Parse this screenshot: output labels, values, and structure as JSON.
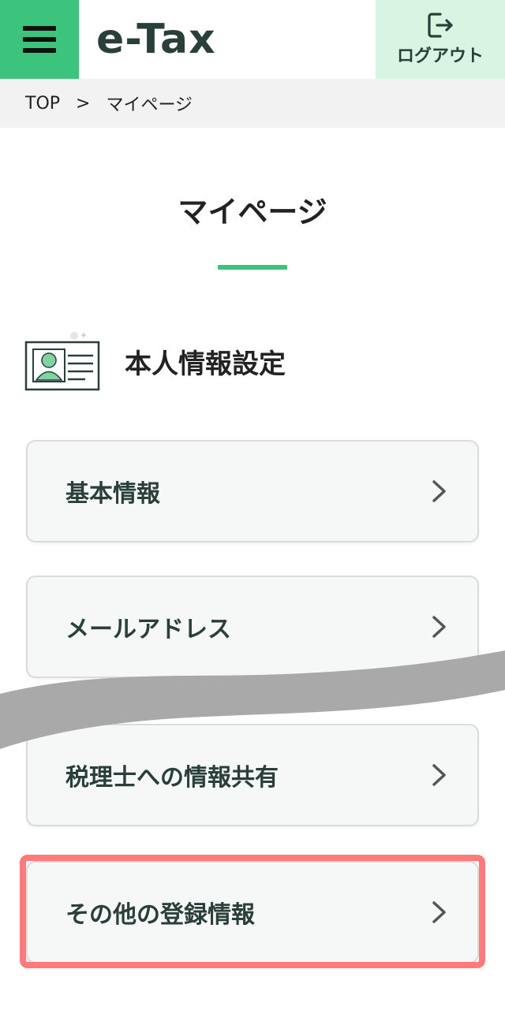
{
  "header": {
    "logo": "e-Tax",
    "logout_label": "ログアウト",
    "menu_icon": "hamburger-menu-icon",
    "logout_icon": "logout-icon",
    "accent_color": "#3cc47c"
  },
  "breadcrumb": {
    "top": "TOP",
    "separator": ">",
    "current": "マイページ"
  },
  "page": {
    "title": "マイページ"
  },
  "section": {
    "title": "本人情報設定",
    "icon": "id-card-icon"
  },
  "menu_items": [
    {
      "label": "基本情報"
    },
    {
      "label": "メールアドレス"
    },
    {
      "label": "税理士への情報共有"
    },
    {
      "label": "その他の登録情報"
    }
  ],
  "highlight_color": "#ff7b7b"
}
